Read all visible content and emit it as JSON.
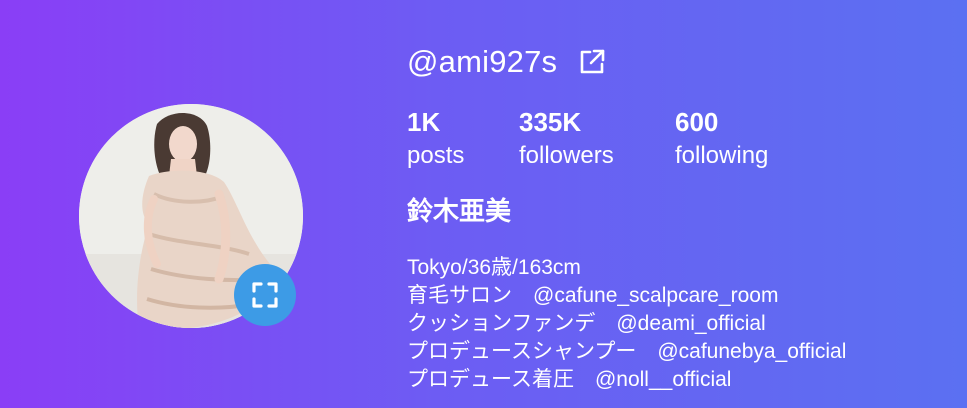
{
  "profile": {
    "username": "@ami927s",
    "display_name": "鈴木亜美",
    "stats": {
      "posts": {
        "count": "1K",
        "label": "posts"
      },
      "followers": {
        "count": "335K",
        "label": "followers"
      },
      "following": {
        "count": "600",
        "label": "following"
      }
    },
    "bio": [
      "Tokyo/36歳/163cm",
      "育毛サロン　@cafune_scalpcare_room",
      "クッションファンデ　@deami_official",
      "プロデュースシャンプー　@cafunebya_official",
      "プロデュース着圧　@noll__official"
    ]
  },
  "icons": {
    "external_link": "external-link-icon",
    "expand": "expand-icon"
  },
  "colors": {
    "gradient_start": "#8a3ef6",
    "gradient_end": "#5b70f2",
    "expand_button": "#3d9be6",
    "text": "#ffffff"
  }
}
